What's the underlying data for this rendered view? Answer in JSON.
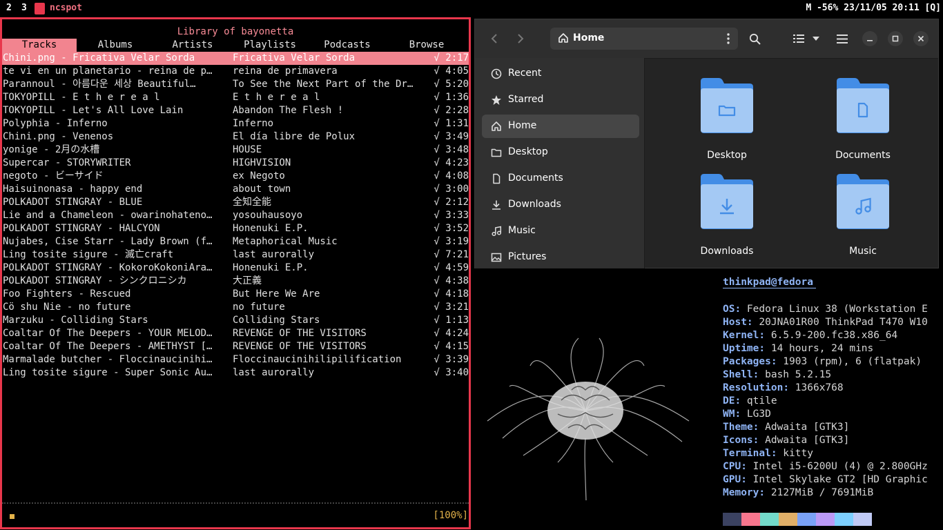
{
  "topbar": {
    "workspaces": [
      "2",
      "3"
    ],
    "window_title": "ncspot",
    "status": "M -56% 23/11/05 20:11 [Q]"
  },
  "ncspot": {
    "title": "Library of bayonetta",
    "tabs": [
      "Tracks",
      "Albums",
      "Artists",
      "Playlists",
      "Podcasts",
      "Browse"
    ],
    "active_tab": "Tracks",
    "tracks": [
      {
        "title": "Chini.png - Fricativa Velar Sorda",
        "album": "Fricativa Velar Sorda",
        "duration": "√ 2:17"
      },
      {
        "title": "te vi en un planetario - reina de p…",
        "album": "reina de primavera",
        "duration": "√ 4:05"
      },
      {
        "title": "Parannoul - 아름다운 세상 Beautiful…",
        "album": "To See the Next Part of the Dr…",
        "duration": "√ 5:20"
      },
      {
        "title": "TOKYOPILL - E t h e r e a l",
        "album": "E t h e r e a l",
        "duration": "√ 1:36"
      },
      {
        "title": "TOKYOPILL - Let's All Love Lain",
        "album": "Abandon The Flesh !",
        "duration": "√ 2:28"
      },
      {
        "title": "Polyphia - Inferno",
        "album": "Inferno",
        "duration": "√ 1:31"
      },
      {
        "title": "Chini.png - Venenos",
        "album": "El día libre de Polux",
        "duration": "√ 3:49"
      },
      {
        "title": "yonige - 2月の水槽",
        "album": "HOUSE",
        "duration": "√ 3:48"
      },
      {
        "title": "Supercar - STORYWRITER",
        "album": "HIGHVISION",
        "duration": "√ 4:23"
      },
      {
        "title": "negoto - ビーサイド",
        "album": "ex Negoto",
        "duration": "√ 4:08"
      },
      {
        "title": "Haisuinonasa - happy end",
        "album": "about town",
        "duration": "√ 3:00"
      },
      {
        "title": "POLKADOT STINGRAY - BLUE",
        "album": "全知全能",
        "duration": "√ 2:12"
      },
      {
        "title": "Lie and a Chameleon - owarinohateno…",
        "album": "yosouhausoyo",
        "duration": "√ 3:33"
      },
      {
        "title": "POLKADOT STINGRAY - HALCYON",
        "album": "Honenuki E.P.",
        "duration": "√ 3:52"
      },
      {
        "title": "Nujabes, Cise Starr - Lady Brown (f…",
        "album": "Metaphorical Music",
        "duration": "√ 3:19"
      },
      {
        "title": "Ling tosite sigure - 滅亡craft",
        "album": "last aurorally",
        "duration": "√ 7:21"
      },
      {
        "title": "POLKADOT STINGRAY - KokoroKokoniAra…",
        "album": "Honenuki E.P.",
        "duration": "√ 4:59"
      },
      {
        "title": "POLKADOT STINGRAY - シンクロニシカ",
        "album": "大正義",
        "duration": "√ 4:38"
      },
      {
        "title": "Foo Fighters - Rescued",
        "album": "But Here We Are",
        "duration": "√ 4:18"
      },
      {
        "title": "Cö shu Nie - no future",
        "album": "no future",
        "duration": "√ 3:21"
      },
      {
        "title": "Marzuku - Colliding Stars",
        "album": "Colliding Stars",
        "duration": "√ 1:13"
      },
      {
        "title": "Coaltar Of The Deepers - YOUR MELOD…",
        "album": "REVENGE OF THE VISITORS",
        "duration": "√ 4:24"
      },
      {
        "title": "Coaltar Of The Deepers - AMETHYST […",
        "album": "REVENGE OF THE VISITORS",
        "duration": "√ 4:15"
      },
      {
        "title": "Marmalade butcher - Floccinaucinihi…",
        "album": "Floccinaucinihilipilification",
        "duration": "√ 3:39"
      },
      {
        "title": "Ling tosite sigure - Super Sonic Au…",
        "album": "last aurorally",
        "duration": "√ 3:40"
      }
    ],
    "selected_index": 0,
    "volume": "[100%]",
    "accent": "#e8374c"
  },
  "files": {
    "location": "Home",
    "sidebar": [
      {
        "label": "Recent",
        "icon": "clock-icon"
      },
      {
        "label": "Starred",
        "icon": "star-icon"
      },
      {
        "label": "Home",
        "icon": "home-icon",
        "active": true
      },
      {
        "label": "Desktop",
        "icon": "folder-icon"
      },
      {
        "label": "Documents",
        "icon": "document-icon"
      },
      {
        "label": "Downloads",
        "icon": "download-icon"
      },
      {
        "label": "Music",
        "icon": "music-icon"
      },
      {
        "label": "Pictures",
        "icon": "picture-icon"
      }
    ],
    "items": [
      {
        "label": "Desktop",
        "icon": "folder-desktop-icon"
      },
      {
        "label": "Documents",
        "icon": "folder-documents-icon"
      },
      {
        "label": "Downloads",
        "icon": "folder-downloads-icon"
      },
      {
        "label": "Music",
        "icon": "folder-music-icon"
      }
    ]
  },
  "neofetch": {
    "user": "thinkpad@fedora",
    "lines": [
      {
        "key": "OS",
        "value": " Fedora Linux 38 (Workstation E"
      },
      {
        "key": "Host",
        "value": " 20JNA01R00 ThinkPad T470 W10"
      },
      {
        "key": "Kernel",
        "value": " 6.5.9-200.fc38.x86_64"
      },
      {
        "key": "Uptime",
        "value": " 14 hours, 24 mins"
      },
      {
        "key": "Packages",
        "value": " 1903 (rpm), 6 (flatpak)"
      },
      {
        "key": "Shell",
        "value": " bash 5.2.15"
      },
      {
        "key": "Resolution",
        "value": " 1366x768"
      },
      {
        "key": "DE",
        "value": " qtile"
      },
      {
        "key": "WM",
        "value": " LG3D"
      },
      {
        "key": "Theme",
        "value": " Adwaita [GTK3]"
      },
      {
        "key": "Icons",
        "value": " Adwaita [GTK3]"
      },
      {
        "key": "Terminal",
        "value": " kitty"
      },
      {
        "key": "CPU",
        "value": " Intel i5-6200U (4) @ 2.800GHz"
      },
      {
        "key": "GPU",
        "value": " Intel Skylake GT2 [HD Graphic"
      },
      {
        "key": "Memory",
        "value": " 2127MiB / 7691MiB"
      }
    ],
    "palette": [
      "#3b4261",
      "#f7768e",
      "#73daca",
      "#e0af68",
      "#7aa2f7",
      "#bb9af7",
      "#7dcfff",
      "#c0caf5"
    ]
  }
}
